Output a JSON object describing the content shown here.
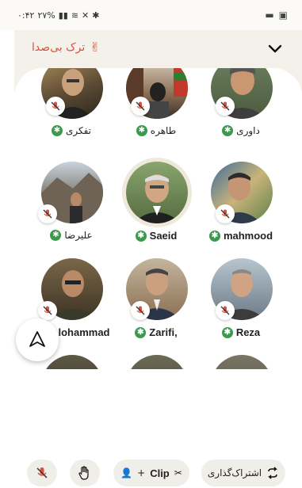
{
  "status": {
    "time": "۰:۴۲",
    "battery": "۲۷%",
    "icons_right": [
      "folder-icon",
      "gallery-icon"
    ]
  },
  "header": {
    "leave_label": "ترک بی‌صدا",
    "leave_emoji": "✌"
  },
  "participants": [
    {
      "name": "تفکری",
      "muted": true,
      "rtl": true
    },
    {
      "name": "طاهره",
      "muted": true,
      "rtl": true
    },
    {
      "name": "داوری",
      "muted": true,
      "rtl": true
    },
    {
      "name": "علیرضا",
      "muted": true,
      "rtl": true
    },
    {
      "name": "Saeid",
      "muted": false,
      "rtl": false
    },
    {
      "name": "mahmood",
      "muted": true,
      "rtl": false
    },
    {
      "name": "lohammad",
      "muted": true,
      "rtl": false
    },
    {
      "name": "Zarifi,",
      "muted": true,
      "rtl": false
    },
    {
      "name": "Reza",
      "muted": true,
      "rtl": false
    }
  ],
  "bottom": {
    "clip_label": "Clip",
    "clip_prefix": "+",
    "share_label": "اشتراک‌گذاری"
  },
  "colors": {
    "accent_red": "#d9523f",
    "badge_green": "#3b9a4b",
    "header_bg": "#f3f1ea"
  }
}
